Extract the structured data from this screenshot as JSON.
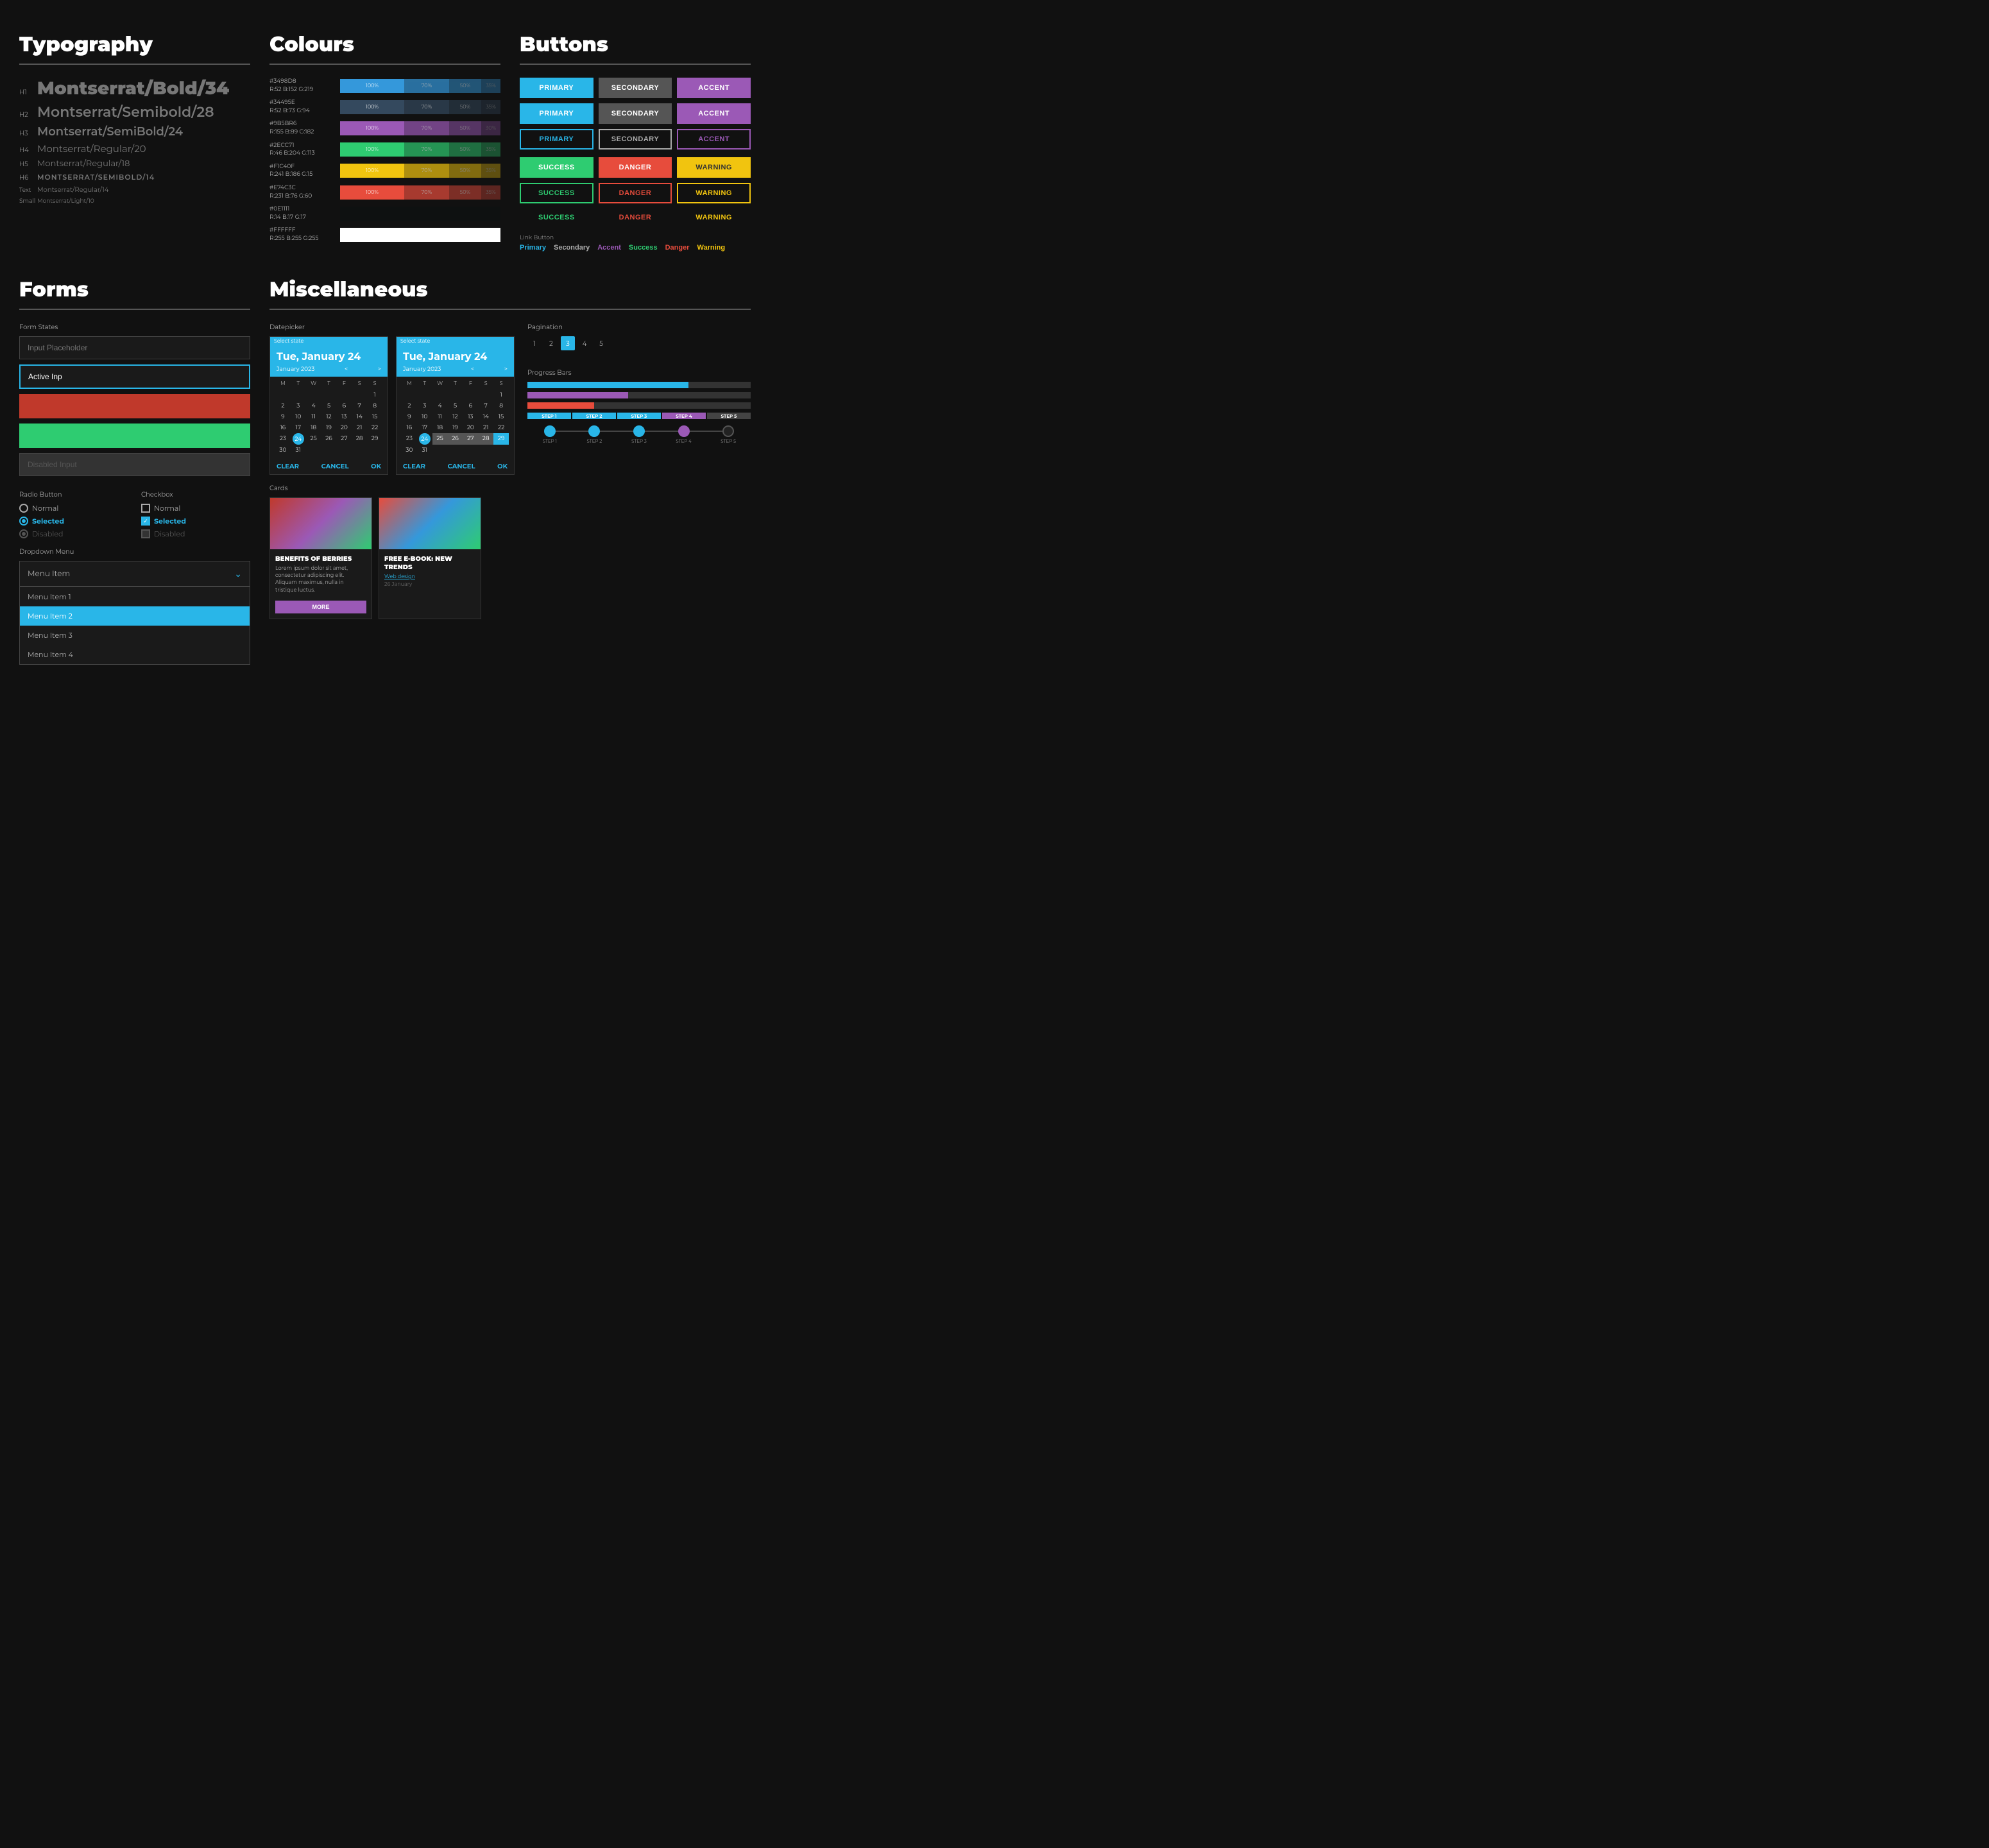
{
  "typography": {
    "title": "Typography",
    "rows": [
      {
        "label": "H1",
        "text": "Montserrat/Bold/34",
        "class": "typo-h1"
      },
      {
        "label": "H2",
        "text": "Montserrat/Semibold/28",
        "class": "typo-h2"
      },
      {
        "label": "H3",
        "text": "Montserrat/SemiBold/24",
        "class": "typo-h3"
      },
      {
        "label": "H4",
        "text": "Montserrat/Regular/20",
        "class": "typo-h4"
      },
      {
        "label": "H5",
        "text": "Montserrat/Regular/18",
        "class": "typo-h5"
      },
      {
        "label": "H6",
        "text": "MONTSERRAT/SEMIBOLD/14",
        "class": "typo-h6"
      },
      {
        "label": "Text",
        "text": "Montserrat/Regular/14",
        "class": "typo-text"
      },
      {
        "label": "Small",
        "text": "Montserrat/Light/10",
        "class": "typo-small"
      }
    ]
  },
  "colours": {
    "title": "Colours",
    "rows": [
      {
        "hex": "#3498D8",
        "rgb": "R:52 B:152 G:219",
        "color": "#3498db",
        "segments": [
          {
            "w": 40,
            "label": "100%",
            "opacity": 1
          },
          {
            "w": 28,
            "label": "70%",
            "opacity": 0.7
          },
          {
            "w": 20,
            "label": "50%",
            "opacity": 0.5
          },
          {
            "w": 12,
            "label": "35%",
            "opacity": 0.35
          }
        ]
      },
      {
        "hex": "#34495E",
        "rgb": "R:52 B:73 G:94",
        "color": "#34495e",
        "segments": [
          {
            "w": 40,
            "label": "100%",
            "opacity": 1
          },
          {
            "w": 28,
            "label": "70%",
            "opacity": 0.7
          },
          {
            "w": 20,
            "label": "50%",
            "opacity": 0.5
          },
          {
            "w": 12,
            "label": "35%",
            "opacity": 0.35
          }
        ]
      },
      {
        "hex": "#9B5BR6",
        "rgb": "R:155 B:89 G:182",
        "color": "#9b59b6",
        "segments": [
          {
            "w": 40,
            "label": "100%",
            "opacity": 1
          },
          {
            "w": 28,
            "label": "70%",
            "opacity": 0.7
          },
          {
            "w": 20,
            "label": "50%",
            "opacity": 0.5
          },
          {
            "w": 12,
            "label": "30%",
            "opacity": 0.3
          }
        ]
      },
      {
        "hex": "#2ECC71",
        "rgb": "R:46 B:204 G:113",
        "color": "#2ecc71",
        "segments": [
          {
            "w": 40,
            "label": "100%",
            "opacity": 1
          },
          {
            "w": 28,
            "label": "70%",
            "opacity": 0.7
          },
          {
            "w": 20,
            "label": "50%",
            "opacity": 0.5
          },
          {
            "w": 12,
            "label": "35%",
            "opacity": 0.35
          }
        ]
      },
      {
        "hex": "#F1C40F",
        "rgb": "R:241 B:186 G:15",
        "color": "#f1c40f",
        "segments": [
          {
            "w": 40,
            "label": "100%",
            "opacity": 1
          },
          {
            "w": 28,
            "label": "70%",
            "opacity": 0.7
          },
          {
            "w": 20,
            "label": "50%",
            "opacity": 0.5
          },
          {
            "w": 12,
            "label": "35%",
            "opacity": 0.35
          }
        ]
      },
      {
        "hex": "#E74C3C",
        "rgb": "R:231 B:76 G:60",
        "color": "#e74c3c",
        "segments": [
          {
            "w": 40,
            "label": "100%",
            "opacity": 1
          },
          {
            "w": 28,
            "label": "70%",
            "opacity": 0.7
          },
          {
            "w": 20,
            "label": "50%",
            "opacity": 0.5
          },
          {
            "w": 12,
            "label": "35%",
            "opacity": 0.35
          }
        ]
      },
      {
        "hex": "#0E1111",
        "rgb": "R:14 B:17 G:17",
        "color": "#0e1111",
        "segments": [
          {
            "w": 40,
            "label": "",
            "opacity": 1
          }
        ]
      },
      {
        "hex": "#FFFFFF",
        "rgb": "R:255 B:255 G:255",
        "color": "#ffffff",
        "segments": [
          {
            "w": 40,
            "label": "",
            "opacity": 1
          }
        ]
      }
    ]
  },
  "buttons": {
    "title": "Buttons",
    "filled_row1": [
      "PRIMARY",
      "SECONDARY",
      "ACCENT"
    ],
    "outlined_row2": [
      "PRIMARY",
      "SECONDARY",
      "ACCENT"
    ],
    "ghost_row3": [
      "PRIMARY",
      "SECONDARY",
      "ACCENT"
    ],
    "status_filled": [
      "SUCCESS",
      "DANGER",
      "WARNING"
    ],
    "status_outlined": [
      "SUCCESS",
      "DANGER",
      "WARNING"
    ],
    "status_ghost": [
      "SUCCESS",
      "DANGER",
      "WARNING"
    ],
    "link_label": "Link Button",
    "links": [
      {
        "text": "Primary",
        "color": "#29b6e8"
      },
      {
        "text": "Secondary",
        "color": "#aaa"
      },
      {
        "text": "Accent",
        "color": "#9b59b6"
      },
      {
        "text": "Success",
        "color": "#2ecc71"
      },
      {
        "text": "Danger",
        "color": "#e74c3c"
      },
      {
        "text": "Warning",
        "color": "#f1c40f"
      }
    ]
  },
  "forms": {
    "title": "Forms",
    "states_label": "Form States",
    "input_placeholder": "Input Placeholder",
    "input_active": "Active Inp",
    "input_error": "",
    "input_success": "",
    "input_disabled": "Disabled Input",
    "radio_label": "Radio Button",
    "radio_items": [
      {
        "label": "Normal",
        "state": "normal"
      },
      {
        "label": "Selected",
        "state": "selected"
      },
      {
        "label": "Disabled",
        "state": "disabled"
      }
    ],
    "checkbox_label": "Checkbox",
    "checkbox_items": [
      {
        "label": "Normal",
        "state": "normal"
      },
      {
        "label": "Selected",
        "state": "selected"
      },
      {
        "label": "Disabled",
        "state": "disabled"
      }
    ],
    "dropdown_label": "Dropdown Menu",
    "dropdown_placeholder": "Menu Item",
    "dropdown_items": [
      "Menu Item 1",
      "Menu Item 2",
      "Menu Item 3",
      "Menu Item 4"
    ]
  },
  "misc": {
    "title": "Miscellaneous",
    "datepicker_label": "Datepicker",
    "dp1": {
      "state": "Select state",
      "header": "Tue, January 24",
      "month": "January 2023",
      "today": "24",
      "clear": "CLEAR",
      "cancel": "CANCEL",
      "ok": "OK"
    },
    "dp2": {
      "state": "Select state",
      "header": "Tue, January 24",
      "month": "January 2023",
      "today": "24",
      "clear": "CLEAR",
      "cancel": "CANCEL",
      "ok": "OK"
    },
    "cards_label": "Cards",
    "card1": {
      "title": "BENEFITS OF BERRIES",
      "text": "Lorem ipsum dolor sit amet, consectetur adipiscing elit. Aliquam maximus, nulla in tristique luctus.",
      "btn": "MORE"
    },
    "card2": {
      "title": "FREE E-BOOK: NEW TRENDS",
      "link": "Web design",
      "date": "26 January"
    },
    "pagination_label": "Pagination",
    "pages": [
      "1",
      "2",
      "3",
      "4",
      "5"
    ],
    "active_page": "3",
    "progress_label": "Progress Bars",
    "progress_bars": [
      {
        "color": "#29b6e8",
        "percent": 72
      },
      {
        "color": "#9b59b6",
        "percent": 45
      },
      {
        "color": "#e74c3c",
        "percent": 30
      }
    ],
    "steps": [
      {
        "label": "STEP 1",
        "state": "done"
      },
      {
        "label": "STEP 2",
        "state": "done"
      },
      {
        "label": "STEP 3",
        "state": "done"
      },
      {
        "label": "STEP 4",
        "state": "active"
      },
      {
        "label": "STEP 5",
        "state": "none"
      }
    ],
    "progress_step_bars": [
      {
        "label": "STEP 1",
        "color": "#29b6e8"
      },
      {
        "label": "STEP 2",
        "color": "#29b6e8"
      },
      {
        "label": "STEP 3",
        "color": "#29b6e8"
      },
      {
        "label": "STEP 4",
        "color": "#9b59b6"
      },
      {
        "label": "STEP 5",
        "color": "#444"
      }
    ]
  }
}
